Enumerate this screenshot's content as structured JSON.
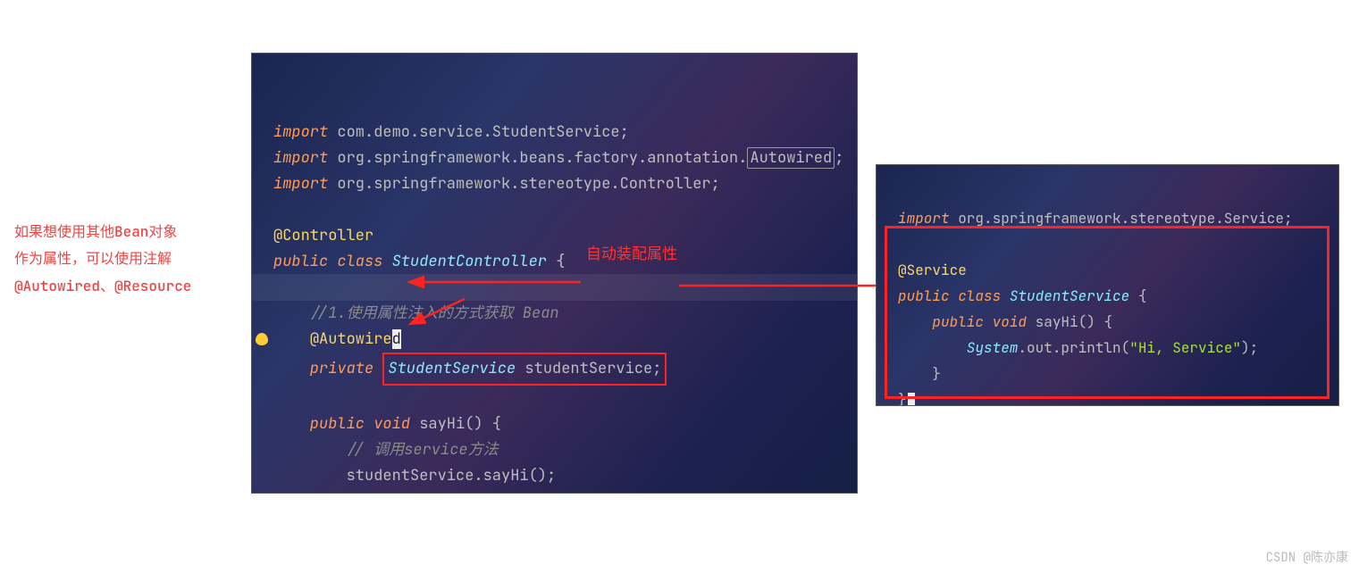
{
  "left_note": {
    "line1": "如果想使用其他Bean对象",
    "line2": "作为属性，可以使用注解",
    "line3": "@Autowired、@Resource"
  },
  "annot": {
    "auto_wire": "自动装配属性"
  },
  "left_code": {
    "l1_kw": "import",
    "l1_id": " com.demo.service.StudentService",
    "l1_semi": ";",
    "l2_kw": "import",
    "l2_id": " org.springframework.beans.factory.annotation.",
    "l2_box": "Autowired",
    "l2_semi": ";",
    "l3_kw": "import",
    "l3_id": " org.springframework.stereotype.Controller",
    "l3_semi": ";",
    "l5_ann": "@Controller",
    "l6_kw1": "public",
    "l6_kw2": " class",
    "l6_type": " StudentController",
    "l6_brace": " {",
    "l8_cmt": "    //1.使用属性注入的方式获取 Bean",
    "l9_ann": "@Autowire",
    "l9_d": "d",
    "l10_kw": "    private ",
    "l10_type": "StudentService",
    "l10_sp": " ",
    "l10_var": "studentService",
    "l10_semi": ";",
    "l12_kw1": "    public",
    "l12_kw2": " void",
    "l12_name": " sayHi",
    "l12_par": "()",
    "l12_brace": " {",
    "l13_cmt": "        // 调用service方法",
    "l14_call": "        studentService.sayHi();",
    "l15_brace": "    }"
  },
  "right_code": {
    "r1_kw": "import",
    "r1_id": " org.springframework.stereotype.Service",
    "r1_semi": ";",
    "r3_ann": "@Service",
    "r4_kw1": "public",
    "r4_kw2": " class",
    "r4_type": " StudentService",
    "r4_brace": " {",
    "r5_kw1": "    public",
    "r5_kw2": " void",
    "r5_name": " sayHi",
    "r5_par": "()",
    "r5_brace": " {",
    "r6_call": "        System",
    "r6_out": ".out",
    "r6_print": ".println(",
    "r6_str": "\"Hi, Service\"",
    "r6_end": ");",
    "r7_brace": "    }",
    "r8_brace": "}"
  },
  "watermark": "CSDN @陈亦康"
}
